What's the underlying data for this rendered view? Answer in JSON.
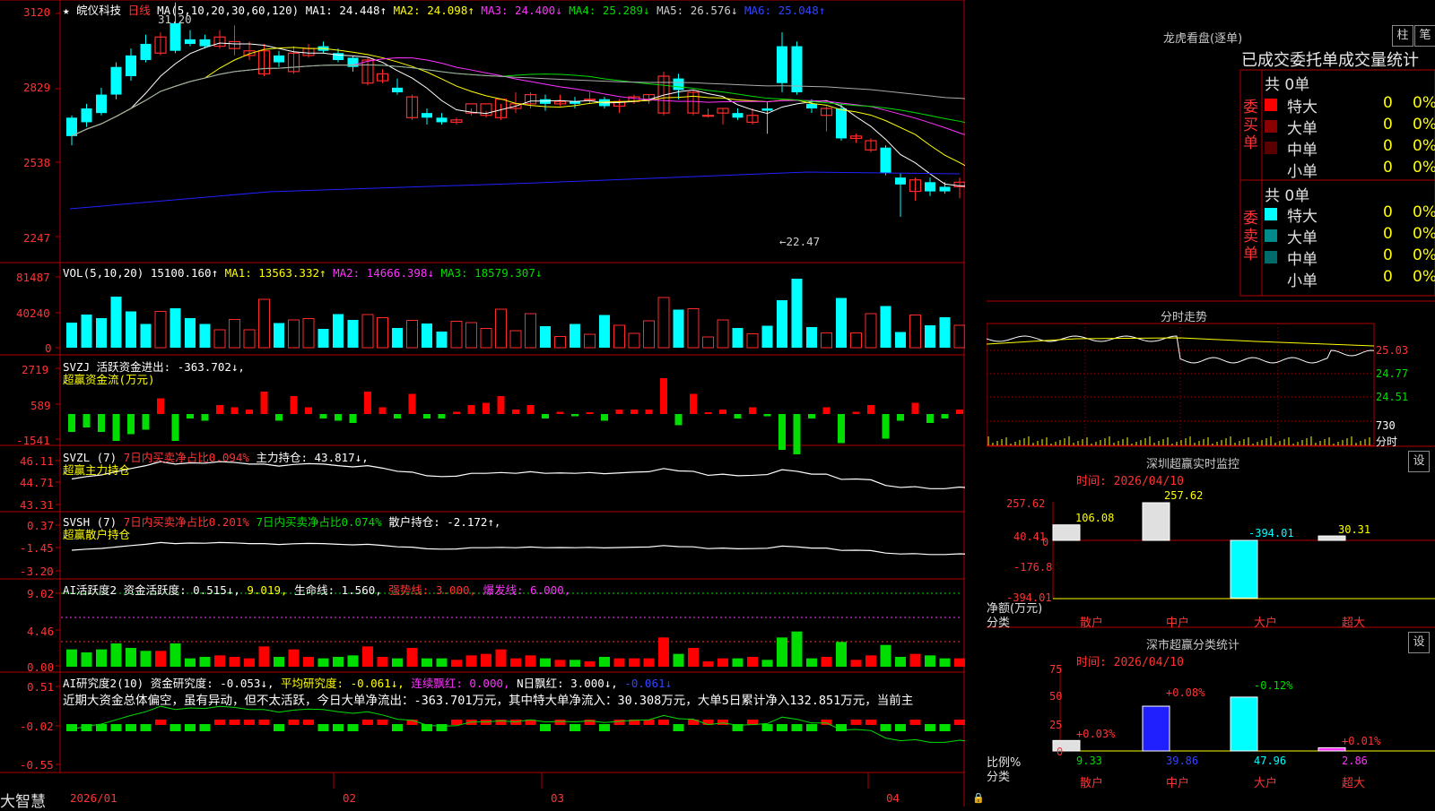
{
  "colors": {
    "up": "#ff2a2a",
    "down": "#00ffff",
    "ma1": "#ffffff",
    "ma2": "#ffff00",
    "ma3": "#ff33ff",
    "ma4": "#00dd00",
    "ma5": "#aaaaaa",
    "ma6": "#2020ff",
    "grid": "#b00000"
  },
  "header": {
    "star": "★",
    "stock": "皖仪科技",
    "period": "日线",
    "ma_label": "MA(5,10,20,30,60,120)",
    "ma1": "MA1: 24.448↑",
    "ma2": "MA2: 24.098↑",
    "ma3": "MA3: 24.400↓",
    "ma4": "MA4: 25.289↓",
    "ma5": "MA5: 26.576↓",
    "ma6": "MA6: 25.048↑",
    "high_note": "31.20",
    "low_note": "←22.47"
  },
  "price_axis": [
    "3120",
    "2829",
    "2538",
    "2247"
  ],
  "vol": {
    "title": "VOL(5,10,20)",
    "value": "15100.160↑",
    "ma1": "MA1: 13563.332↑",
    "ma2": "MA2: 14666.398↓",
    "ma3": "MA3: 18579.307↓",
    "axis": [
      "81487",
      "40240",
      "0"
    ]
  },
  "svzj": {
    "title": "SVZJ",
    "label": "活跃资金进出: -363.702↓,",
    "sub": "超赢资金流(万元)",
    "axis": [
      "2719",
      "589",
      "-1541"
    ]
  },
  "svzl": {
    "title": "SVZL (7)",
    "label1": "7日内买卖净占比0.094%",
    "label2": "主力持仓: 43.817↓,",
    "sub": "超赢主力持仓",
    "axis": [
      "46.11",
      "44.71",
      "43.31"
    ]
  },
  "svsh": {
    "title": "SVSH (7)",
    "label1": "7日内买卖净占比0.201%",
    "label2": "7日内买卖净占比0.074%",
    "label3": "散户持仓: -2.172↑,",
    "sub": "超赢散户持仓",
    "axis": [
      "0.37",
      "-1.45",
      "-3.20"
    ]
  },
  "ai1": {
    "title": "AI活跃度2",
    "label1": "资金活跃度: 0.515↓,",
    "label2": "9.019,",
    "label3": "生命线: 1.560,",
    "label4": "强势线: 3.000,",
    "label5": "爆发线: 6.000,",
    "axis": [
      "9.02",
      "4.46",
      "0.00"
    ]
  },
  "ai2": {
    "title": "AI研究度2(10)",
    "label1": "资金研究度: -0.053↓,",
    "label2": "平均研究度: -0.061↓,",
    "label3": "连续飘红: 0.000,",
    "label4": "N日飘红: 3.000↓,",
    "label5": "-0.061↓",
    "summary": "近期大资金总体偏空，虽有异动，但不太活跃，今日大单净流出：-363.701万元，其中特大单净流入：30.308万元，大单5日累计净入132.851万元，当前主",
    "axis": [
      "0.51",
      "-0.02",
      "-0.55"
    ]
  },
  "xaxis": {
    "brand": "大智慧",
    "labels": [
      "2026/01",
      "02",
      "03",
      "04"
    ]
  },
  "right": {
    "dragon_title": "龙虎看盘(逐单)",
    "btn1": "柱",
    "btn2": "笔",
    "col_header": "已成交委托单成交量统计",
    "buy_side": "委买单",
    "sell_side": "委卖单",
    "buy_total": "共 0单",
    "sell_total": "共 0单",
    "buy_rows": [
      {
        "label": "特大",
        "count": "0",
        "pct": "0%"
      },
      {
        "label": "大单",
        "count": "0",
        "pct": "0%"
      },
      {
        "label": "中单",
        "count": "0",
        "pct": "0%"
      },
      {
        "label": "小单",
        "count": "0",
        "pct": "0%"
      }
    ],
    "sell_rows": [
      {
        "label": "特大",
        "count": "0",
        "pct": "0%"
      },
      {
        "label": "大单",
        "count": "0",
        "pct": "0%"
      },
      {
        "label": "中单",
        "count": "0",
        "pct": "0%"
      },
      {
        "label": "小单",
        "count": "0",
        "pct": "0%"
      }
    ],
    "intraday_title": "分时走势",
    "intraday_axis": [
      "25.03",
      "24.77",
      "24.51",
      "730",
      "分时"
    ],
    "monitor_title": "深圳超赢实时监控",
    "monitor_btn": "设",
    "monitor_time": "时间: 2026/04/10",
    "monitor_axis": [
      "257.62",
      "40.41",
      "0",
      "-176.8",
      "-394.01"
    ],
    "monitor_vals": [
      "106.08",
      "257.62",
      "-394.01",
      "30.31"
    ],
    "monitor_ylabel": "净额(万元)",
    "monitor_xlabel": "分类",
    "cats": [
      "散户",
      "中户",
      "大户",
      "超大"
    ],
    "stat_title": "深市超赢分类统计",
    "stat_btn": "设",
    "stat_time": "时间: 2026/04/10",
    "stat_axis": [
      "75",
      "50",
      "25",
      "0"
    ],
    "stat_vals": [
      "9.33",
      "39.86",
      "47.96",
      "2.86"
    ],
    "stat_changes": [
      "+0.03%",
      "+0.08%",
      "-0.12%",
      "+0.01%"
    ],
    "stat_ylabel": "比例%",
    "stat_xlabel": "分类"
  },
  "chart_data": {
    "type": "candlestick",
    "candles": [
      [
        2680,
        2600,
        2690,
        2560
      ],
      [
        2720,
        2660,
        2740,
        2640
      ],
      [
        2780,
        2700,
        2810,
        2690
      ],
      [
        2900,
        2780,
        2920,
        2760
      ],
      [
        2950,
        2860,
        2980,
        2840
      ],
      [
        3000,
        2930,
        3040,
        2920
      ],
      [
        2960,
        3030,
        3050,
        2950
      ],
      [
        3090,
        2970,
        3180,
        2960
      ],
      [
        3020,
        3000,
        3060,
        2990
      ],
      [
        3020,
        2990,
        3040,
        2980
      ],
      [
        2990,
        3030,
        3060,
        2980
      ],
      [
        2980,
        3010,
        3080,
        2950
      ],
      [
        2950,
        2970,
        3010,
        2930
      ],
      [
        2870,
        2970,
        3000,
        2860
      ],
      [
        2950,
        2920,
        2970,
        2900
      ],
      [
        2880,
        2960,
        2990,
        2870
      ],
      [
        2950,
        2980,
        3000,
        2940
      ],
      [
        2990,
        2970,
        3010,
        2960
      ],
      [
        2960,
        2930,
        2980,
        2920
      ],
      [
        2940,
        2900,
        2950,
        2880
      ],
      [
        2830,
        2930,
        2940,
        2820
      ],
      [
        2840,
        2870,
        2890,
        2830
      ],
      [
        2810,
        2790,
        2850,
        2780
      ],
      [
        2680,
        2770,
        2780,
        2670
      ],
      [
        2700,
        2680,
        2720,
        2650
      ],
      [
        2680,
        2660,
        2700,
        2650
      ],
      [
        2660,
        2670,
        2680,
        2650
      ],
      [
        2700,
        2740,
        2720,
        2690
      ],
      [
        2690,
        2740,
        2710,
        2680
      ],
      [
        2680,
        2760,
        2740,
        2670
      ],
      [
        2720,
        2740,
        2790,
        2700
      ],
      [
        2740,
        2780,
        2790,
        2720
      ],
      [
        2760,
        2740,
        2780,
        2710
      ],
      [
        2740,
        2750,
        2780,
        2730
      ],
      [
        2750,
        2740,
        2770,
        2720
      ],
      [
        2760,
        2760,
        2790,
        2740
      ],
      [
        2760,
        2730,
        2770,
        2720
      ],
      [
        2730,
        2750,
        2760,
        2700
      ],
      [
        2750,
        2770,
        2780,
        2740
      ],
      [
        2760,
        2780,
        2780,
        2740
      ],
      [
        2700,
        2860,
        2880,
        2690
      ],
      [
        2850,
        2800,
        2870,
        2760
      ],
      [
        2700,
        2790,
        2800,
        2690
      ],
      [
        2690,
        2690,
        2720,
        2680
      ],
      [
        2700,
        2720,
        2720,
        2650
      ],
      [
        2700,
        2680,
        2720,
        2670
      ],
      [
        2660,
        2690,
        2720,
        2650
      ],
      [
        2720,
        2710,
        2750,
        2610
      ],
      [
        2990,
        2830,
        3050,
        2790
      ],
      [
        2990,
        2790,
        3010,
        2780
      ],
      [
        2740,
        2720,
        2760,
        2700
      ],
      [
        2690,
        2720,
        2730,
        2620
      ],
      [
        2720,
        2590,
        2740,
        2580
      ],
      [
        2590,
        2600,
        2610,
        2570
      ],
      [
        2540,
        2580,
        2590,
        2530
      ],
      [
        2550,
        2440,
        2560,
        2430
      ],
      [
        2420,
        2390,
        2440,
        2250
      ],
      [
        2360,
        2410,
        2420,
        2320
      ],
      [
        2400,
        2360,
        2420,
        2340
      ],
      [
        2380,
        2360,
        2400,
        2350
      ],
      [
        2380,
        2400,
        2420,
        2330
      ],
      [
        2330,
        2370,
        2380,
        2320
      ],
      [
        2400,
        2380,
        2420,
        2370
      ],
      [
        2390,
        2360,
        2400,
        2350
      ],
      [
        2320,
        2360,
        2370,
        2300
      ],
      [
        2340,
        2370,
        2390,
        2330
      ],
      [
        2360,
        2380,
        2380,
        2350
      ],
      [
        2420,
        2430,
        2450,
        2410
      ],
      [
        2430,
        2440,
        2450,
        2420
      ],
      [
        2460,
        2450,
        2480,
        2440
      ]
    ],
    "xlabels": [
      "2026/01",
      "02",
      "03",
      "04"
    ],
    "ylim": [
      2160,
      3140
    ]
  }
}
